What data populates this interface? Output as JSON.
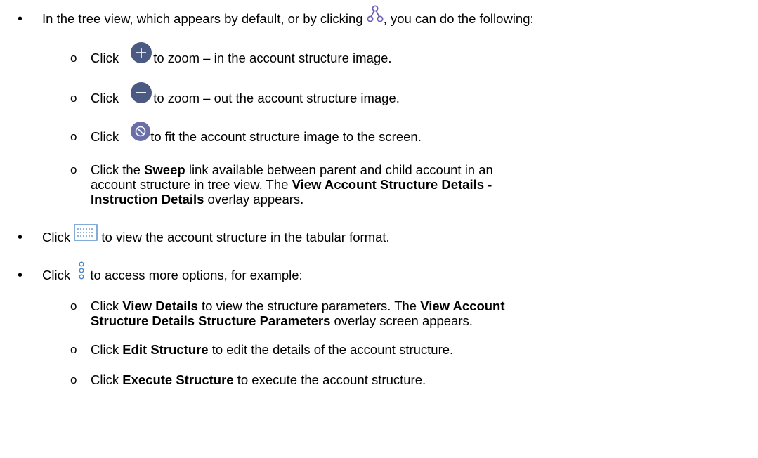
{
  "bullets": {
    "filled": "•",
    "hollow": "o"
  },
  "tree_view": {
    "prefix": "In the tree view, which appears by default, or by clicking ",
    "suffix": ", you can do the following:",
    "icon": "tree-view-icon"
  },
  "zoom_in": {
    "click": "Click ",
    "suffix": "to zoom – in the account structure image.",
    "icon": "zoom-in-icon"
  },
  "zoom_out": {
    "click": "Click ",
    "suffix": "to zoom – out the account structure image.",
    "icon": "zoom-out-icon"
  },
  "fit": {
    "click": "Click ",
    "suffix": "to fit the account structure image to the screen.",
    "icon": "fit-screen-icon"
  },
  "sweep": {
    "l1_a": "Click the ",
    "l1_b": "Sweep",
    "l1_c": " link available between parent and child account in an",
    "l2_a": "account structure in tree view. The ",
    "l2_b": "View Account Structure Details -",
    "l3_b": "Instruction Details",
    "l3_c": " overlay appears."
  },
  "tabular": {
    "click": "Click ",
    "suffix": " to view the account structure in the tabular format.",
    "icon": "tabular-view-icon"
  },
  "more": {
    "click": "Click ",
    "suffix": " to access more options, for example:",
    "icon": "more-options-icon"
  },
  "view_details": {
    "l1_a": "Click ",
    "l1_b": "View Details",
    "l1_c": " to view the structure parameters. The ",
    "l1_d": "View Account",
    "l2_b": "Structure Details Structure Parameters",
    "l2_c": " overlay screen appears."
  },
  "edit": {
    "a": "Click ",
    "b": "Edit Structure",
    "c": " to edit the details of the account structure."
  },
  "execute": {
    "a": "Click ",
    "b": "Execute Structure",
    "c": " to execute the account structure."
  },
  "colors": {
    "tree_icon": "#6b5fb5",
    "zoom_icon": "#4a5a82",
    "fit_icon": "#6b6fa8",
    "tab_icon": "#4f86c6",
    "more_icon": "#4f86c6"
  }
}
